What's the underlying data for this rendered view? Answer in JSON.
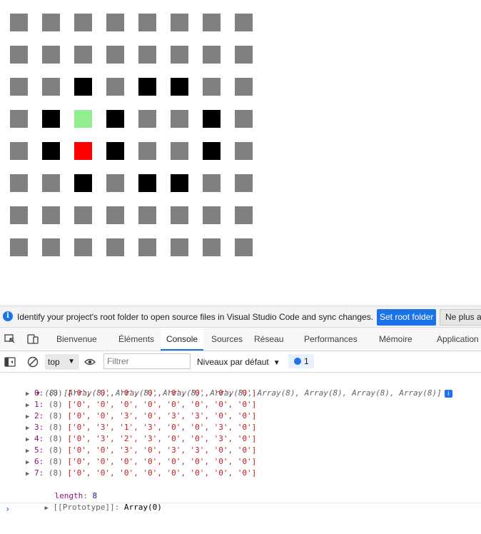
{
  "grid": [
    [
      "0",
      "0",
      "0",
      "0",
      "0",
      "0",
      "0",
      "0"
    ],
    [
      "0",
      "0",
      "0",
      "0",
      "0",
      "0",
      "0",
      "0"
    ],
    [
      "0",
      "0",
      "3",
      "0",
      "3",
      "3",
      "0",
      "0"
    ],
    [
      "0",
      "3",
      "1",
      "3",
      "0",
      "0",
      "3",
      "0"
    ],
    [
      "0",
      "3",
      "2",
      "3",
      "0",
      "0",
      "3",
      "0"
    ],
    [
      "0",
      "0",
      "3",
      "0",
      "3",
      "3",
      "0",
      "0"
    ],
    [
      "0",
      "0",
      "0",
      "0",
      "0",
      "0",
      "0",
      "0"
    ],
    [
      "0",
      "0",
      "0",
      "0",
      "0",
      "0",
      "0",
      "0"
    ]
  ],
  "cell_colors": {
    "0": "#808080",
    "1": "#90ee90",
    "2": "#ff0000",
    "3": "#000000"
  },
  "banner": {
    "message": "Identify your project's root folder to open source files in Visual Studio Code and sync changes.",
    "set_root_label": "Set root folder",
    "dismiss_label": "Ne plus af"
  },
  "tabs": [
    "Bienvenue",
    "Éléments",
    "Console",
    "Sources",
    "Réseau",
    "Performances",
    "Mémoire",
    "Application"
  ],
  "active_tab": "Console",
  "toolbar": {
    "context": "top",
    "filter_placeholder": "Filtrer",
    "levels_label": "Niveaux par défaut",
    "message_count": "1"
  },
  "console": {
    "summary": "(8) [Array(8), Array(8), Array(8), Array(8), Array(8), Array(8), Array(8), Array(8)]",
    "info_badge": "i",
    "rows": [
      {
        "index": "0",
        "len": "(8)",
        "vals": "['0', '0', '0', '0', '0', '0', '0', '0']"
      },
      {
        "index": "1",
        "len": "(8)",
        "vals": "['0', '0', '0', '0', '0', '0', '0', '0']"
      },
      {
        "index": "2",
        "len": "(8)",
        "vals": "['0', '0', '3', '0', '3', '3', '0', '0']"
      },
      {
        "index": "3",
        "len": "(8)",
        "vals": "['0', '3', '1', '3', '0', '0', '3', '0']"
      },
      {
        "index": "4",
        "len": "(8)",
        "vals": "['0', '3', '2', '3', '0', '0', '3', '0']"
      },
      {
        "index": "5",
        "len": "(8)",
        "vals": "['0', '0', '3', '0', '3', '3', '0', '0']"
      },
      {
        "index": "6",
        "len": "(8)",
        "vals": "['0', '0', '0', '0', '0', '0', '0', '0']"
      },
      {
        "index": "7",
        "len": "(8)",
        "vals": "['0', '0', '0', '0', '0', '0', '0', '0']"
      }
    ],
    "length_key": "length",
    "length_value": "8",
    "prototype_key": "[[Prototype]]",
    "prototype_value": "Array(0)",
    "prompt": "›"
  }
}
